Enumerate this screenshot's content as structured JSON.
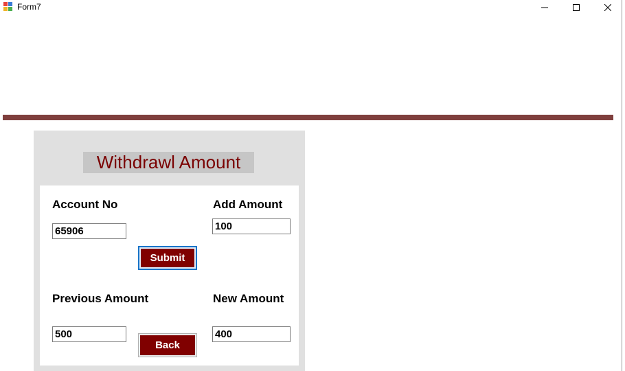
{
  "window": {
    "title": "Form7",
    "icon": "winforms-app-icon",
    "controls": [
      "minimize-icon",
      "maximize-icon",
      "close-icon"
    ]
  },
  "colors": {
    "divider": "#7f3f3d",
    "heading_text": "#7a0000",
    "button_bg": "#800000",
    "panel_bg": "#e0e0e0"
  },
  "form": {
    "heading": "Withdrawl Amount",
    "account_no": {
      "label": "Account No",
      "value": "65906"
    },
    "add_amount": {
      "label": "Add Amount",
      "value": "100"
    },
    "previous_amount": {
      "label": "Previous Amount",
      "value": "500"
    },
    "new_amount": {
      "label": "New Amount",
      "value": "400"
    },
    "submit_label": "Submit",
    "back_label": "Back"
  }
}
